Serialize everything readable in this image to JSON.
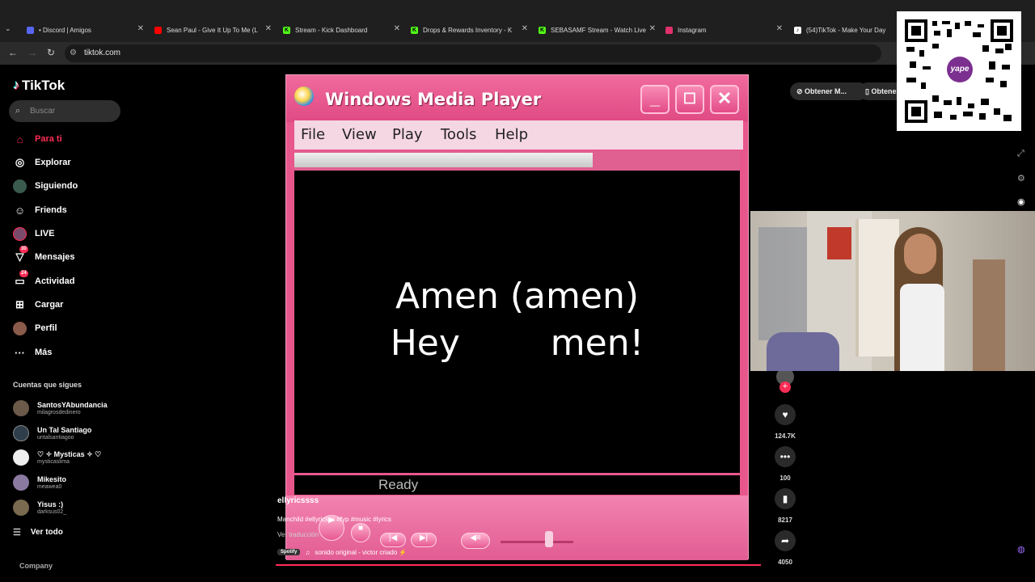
{
  "browser": {
    "tabs": [
      {
        "title": "• Discord | Amigos",
        "icon_color": "#5865f2"
      },
      {
        "title": "Sean Paul - Give It Up To Me (L",
        "icon_color": "#ff0000"
      },
      {
        "title": "Stream - Kick Dashboard",
        "icon_color": "#53fc18"
      },
      {
        "title": "Drops & Rewards Inventory - K",
        "icon_color": "#53fc18"
      },
      {
        "title": "SEBASAMF Stream - Watch Live",
        "icon_color": "#53fc18"
      },
      {
        "title": "Instagram",
        "icon_color": "#e1306c"
      },
      {
        "title": "(54)TikTok - Make Your Day",
        "icon_color": "#ffffff"
      }
    ],
    "url": "tiktok.com"
  },
  "tiktok": {
    "logo": "TikTok",
    "search_placeholder": "Buscar",
    "nav": [
      {
        "label": "Para ti",
        "icon": "home-icon"
      },
      {
        "label": "Explorar",
        "icon": "compass-icon"
      },
      {
        "label": "Siguiendo",
        "icon": "following-icon"
      },
      {
        "label": "Friends",
        "icon": "friends-icon"
      },
      {
        "label": "LIVE",
        "icon": "live-icon"
      },
      {
        "label": "Mensajes",
        "icon": "messages-icon",
        "badge": "30"
      },
      {
        "label": "Actividad",
        "icon": "activity-icon",
        "badge": "24"
      },
      {
        "label": "Cargar",
        "icon": "upload-icon"
      },
      {
        "label": "Perfil",
        "icon": "profile-icon"
      },
      {
        "label": "Más",
        "icon": "more-icon"
      }
    ],
    "following_title": "Cuentas que sigues",
    "following": [
      {
        "name": "SantosYAbundancia",
        "handle": "milagrosdedinero"
      },
      {
        "name": "Un Tal Santiago",
        "handle": "untalsantiagoo"
      },
      {
        "name": "♡ ✧ Mysticas ✧ ♡",
        "handle": "mysticaslima"
      },
      {
        "name": "Mikesito",
        "handle": "meawea0"
      },
      {
        "name": "Yisus :)",
        "handle": "darksus02_"
      }
    ],
    "see_all": "Ver todo",
    "company": "Company",
    "top_buttons": [
      "Obtener M...",
      "Obtener"
    ],
    "video": {
      "user": "ellyricssss",
      "caption": "Manchild #ellyricsss #fyp #music #lyrics",
      "translate": "Ver traducción",
      "spotify": "Spotify",
      "sound": "sonido original - victor criado ⚡",
      "progress": 1.0
    },
    "actions": {
      "likes": "124.7K",
      "comments": "100",
      "saves": "8217",
      "shares": "4050"
    }
  },
  "wmp": {
    "title": "Windows Media Player",
    "menu": [
      "File",
      "View",
      "Play",
      "Tools",
      "Help"
    ],
    "lyrics": [
      "Amen (amen)",
      "Hey        men!"
    ],
    "status": "Ready",
    "seek_fraction": 0.67
  },
  "qr": {
    "brand": "yape"
  }
}
